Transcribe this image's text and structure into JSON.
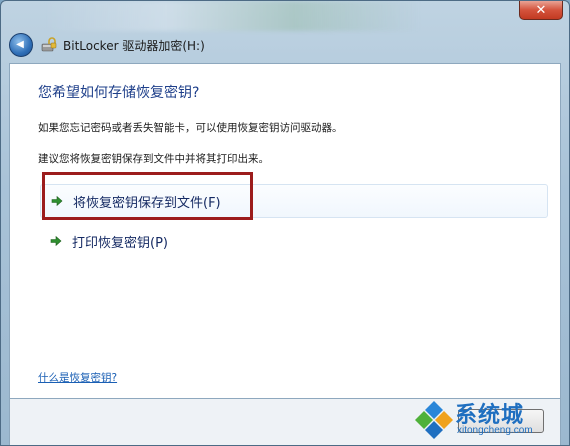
{
  "window": {
    "title": "BitLocker 驱动器加密(H:)",
    "close_glyph": "✕",
    "back_glyph": "◀"
  },
  "main": {
    "heading": "您希望如何存储恢复密钥?",
    "description": "如果您忘记密码或者丢失智能卡，可以使用恢复密钥访问驱动器。",
    "suggestion": "建议您将恢复密钥保存到文件中并将其打印出来。",
    "options": [
      {
        "label": "将恢复密钥保存到文件(F)",
        "icon": "green-arrow-icon"
      },
      {
        "label": "打印恢复密钥(P)",
        "icon": "green-arrow-icon"
      }
    ],
    "help_link": "什么是恢复密钥?"
  },
  "watermark": {
    "brand": "系统城",
    "url": "xitongcheng.com"
  },
  "colors": {
    "heading": "#1e3f8a",
    "highlight_border": "#9c1c1c",
    "arrow": "#2f8f2f",
    "link": "#1a5fb4"
  }
}
